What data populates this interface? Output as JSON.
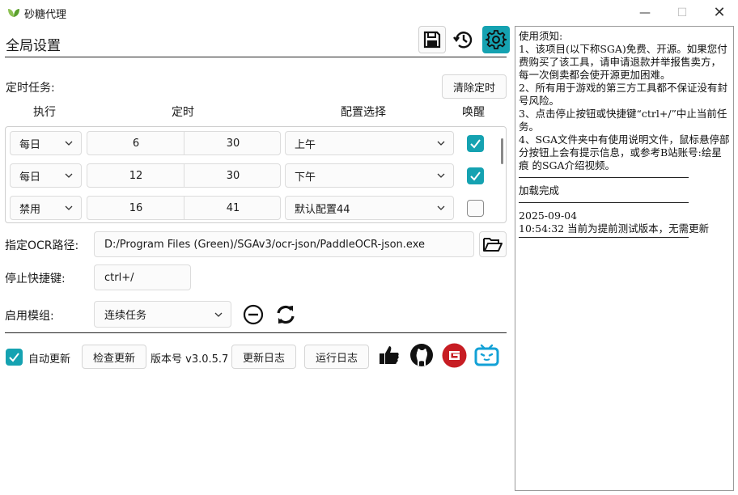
{
  "window": {
    "title": "砂糖代理",
    "minimize": "—",
    "maximize": "☐",
    "close": "✕"
  },
  "header": {
    "title": "全局设置",
    "save_icon": "save-icon",
    "history_icon": "history-icon",
    "settings_icon": "gear-icon",
    "accent": "#15a2b1"
  },
  "schedule": {
    "label": "定时任务:",
    "clear_button": "清除定时",
    "columns": [
      "执行",
      "定时",
      "配置选择",
      "唤醒"
    ],
    "rows": [
      {
        "mode": "每日",
        "hour": "6",
        "minute": "30",
        "config": "上午",
        "wake": true
      },
      {
        "mode": "每日",
        "hour": "12",
        "minute": "30",
        "config": "下午",
        "wake": true
      },
      {
        "mode": "禁用",
        "hour": "16",
        "minute": "41",
        "config": "默认配置44",
        "wake": false
      }
    ]
  },
  "ocr": {
    "label": "指定OCR路径:",
    "path": "D:/Program Files (Green)/SGAv3/ocr-json/PaddleOCR-json.exe",
    "browse_icon": "folder-open-icon"
  },
  "hotkey": {
    "label": "停止快捷键:",
    "value": "ctrl+/"
  },
  "module": {
    "label": "启用模组:",
    "value": "连续任务",
    "remove_icon": "minus-circle-icon",
    "refresh_icon": "refresh-icon"
  },
  "footer": {
    "auto_update_label": "自动更新",
    "auto_update_checked": true,
    "check_update": "检查更新",
    "version": "版本号 v3.0.5.7",
    "changelog": "更新日志",
    "run_log": "运行日志",
    "icons": [
      "thumbs-up-icon",
      "github-icon",
      "gitee-icon",
      "bilibili-icon"
    ]
  },
  "log": {
    "notice": "使用须知:\n1、该项目(以下称SGA)免费、开源。如果您付费购买了该工具，请申请退款并举报售卖方，每一次倒卖都会使开源更加困难。\n2、所有用于游戏的第三方工具都不保证没有封号风险。\n3、点击停止按钮或快捷键“ctrl+/”中止当前任务。\n4、SGA文件夹中有使用说明文件，鼠标悬停部分按钮上会有提示信息，或参考B站账号:绘星痕 的SGA介绍视频。",
    "load_done": "加载完成",
    "date": "2025-09-04",
    "time_message": "10:54:32 当前为提前测试版本，无需更新"
  }
}
